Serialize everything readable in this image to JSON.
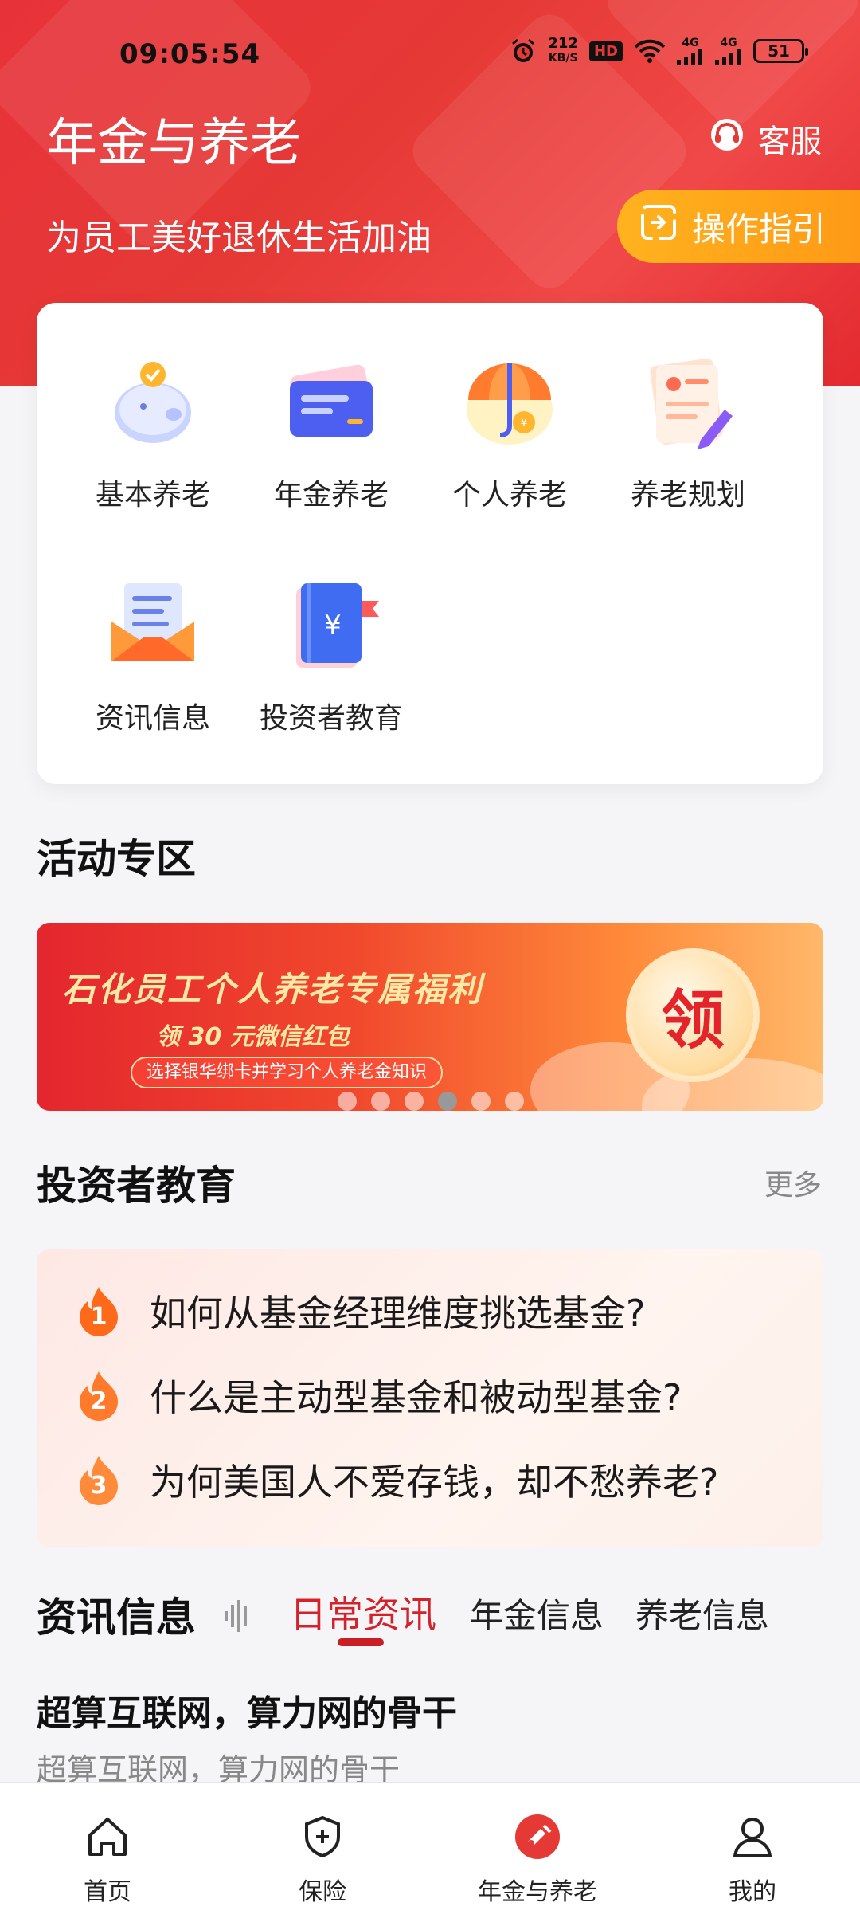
{
  "status_bar": {
    "time": "09:05:54",
    "net_speed_value": "212",
    "net_speed_unit": "KB/S",
    "hd_badge": "HD",
    "signal_1": "4G",
    "signal_2": "4G",
    "battery": "51"
  },
  "header": {
    "title": "年金与养老",
    "service_label": "客服",
    "subtitle": "为员工美好退休生活加油",
    "guide_label": "操作指引"
  },
  "features": [
    {
      "label": "基本养老",
      "icon": "piggy-bank-icon"
    },
    {
      "label": "年金养老",
      "icon": "card-icon"
    },
    {
      "label": "个人养老",
      "icon": "umbrella-icon"
    },
    {
      "label": "养老规划",
      "icon": "planning-doc-icon"
    },
    {
      "label": "资讯信息",
      "icon": "mail-envelope-icon"
    },
    {
      "label": "投资者教育",
      "icon": "book-yuan-icon"
    }
  ],
  "activity": {
    "section_title": "活动专区",
    "banner_title": "石化员工个人养老专属福利",
    "banner_sub": "领 30 元微信红包",
    "banner_tag": "选择银华绑卡并学习个人养老金知识",
    "banner_coin": "领",
    "carousel_active_index": 3,
    "carousel_count": 6
  },
  "education": {
    "section_title": "投资者教育",
    "more_label": "更多",
    "items": [
      {
        "rank": "1",
        "question": "如何从基金经理维度挑选基金?"
      },
      {
        "rank": "2",
        "question": "什么是主动型基金和被动型基金?"
      },
      {
        "rank": "3",
        "question": "为何美国人不爱存钱，却不愁养老?"
      }
    ]
  },
  "news": {
    "section_title": "资讯信息",
    "tabs": [
      "日常资讯",
      "年金信息",
      "养老信息"
    ],
    "active_tab": 0,
    "item_title": "超算互联网，算力网的骨干",
    "item_sub": "超算互联网，算力网的骨干"
  },
  "bottom_nav": [
    {
      "label": "首页",
      "icon": "home-icon"
    },
    {
      "label": "保险",
      "icon": "shield-plus-icon"
    },
    {
      "label": "年金与养老",
      "icon": "pension-icon",
      "active": true
    },
    {
      "label": "我的",
      "icon": "user-icon"
    }
  ],
  "colors": {
    "brand_red": "#e53935",
    "guide_orange": "#ff9a16",
    "active_tab_red": "#d3222a"
  }
}
